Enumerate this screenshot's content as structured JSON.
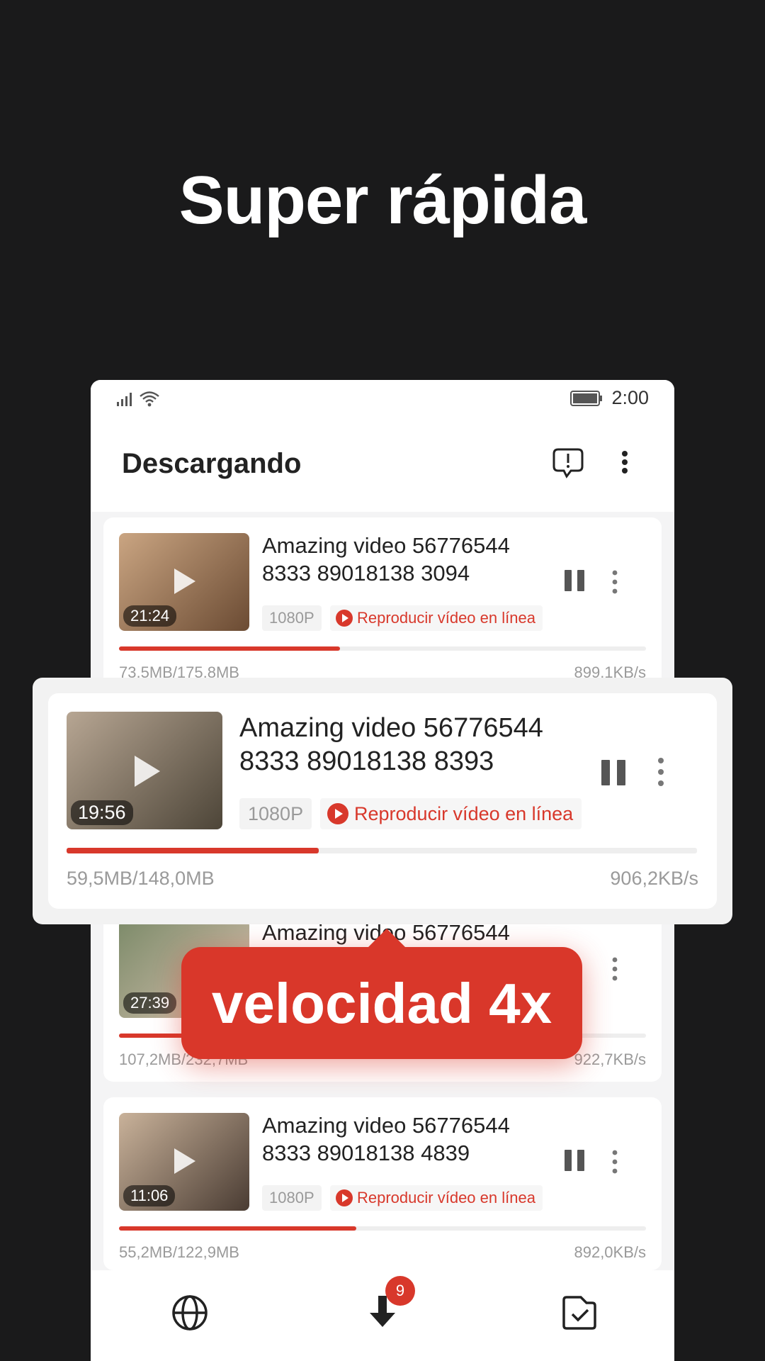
{
  "headline": "Super rápida",
  "status_bar": {
    "time": "2:00"
  },
  "top_bar": {
    "title": "Descargando"
  },
  "downloads": [
    {
      "title": "Amazing video 56776544 8333 89018138 3094",
      "duration": "21:24",
      "resolution": "1080P",
      "play_online": "Reproducir vídeo en línea",
      "size": "73,5MB/175,8MB",
      "speed": "899,1KB/s",
      "progress": 0.42,
      "thumb_colors": [
        "#caa582",
        "#6b4b33"
      ]
    },
    {
      "title": "Amazing video 56776544 8333 89018138 8393",
      "duration": "19:56",
      "resolution": "1080P",
      "play_online": "Reproducir vídeo en línea",
      "size": "59,5MB/148,0MB",
      "speed": "906,2KB/s",
      "progress": 0.4,
      "thumb_colors": [
        "#b7a693",
        "#4d4538"
      ]
    },
    {
      "title": "Amazing video 56776544",
      "duration": "27:39",
      "size": "107,2MB/232,7MB",
      "speed": "922,7KB/s",
      "progress": 0.46,
      "thumb_colors": [
        "#7d8b6a",
        "#d7c2b0"
      ]
    },
    {
      "title": "Amazing video 56776544 8333 89018138 4839",
      "duration": "11:06",
      "resolution": "1080P",
      "play_online": "Reproducir vídeo en línea",
      "size": "55,2MB/122,9MB",
      "speed": "892,0KB/s",
      "progress": 0.45,
      "thumb_colors": [
        "#c9b29a",
        "#4a3c33"
      ]
    }
  ],
  "callout": "velocidad 4x",
  "bottom_nav": {
    "badge": "9"
  },
  "colors": {
    "accent": "#d8382b",
    "background": "#1a1a1b"
  },
  "icons": [
    "signal-icon",
    "wifi-icon",
    "battery-icon",
    "feedback-icon",
    "more-vert-icon",
    "pause-icon",
    "globe-icon",
    "download-icon",
    "check-folder-icon"
  ]
}
